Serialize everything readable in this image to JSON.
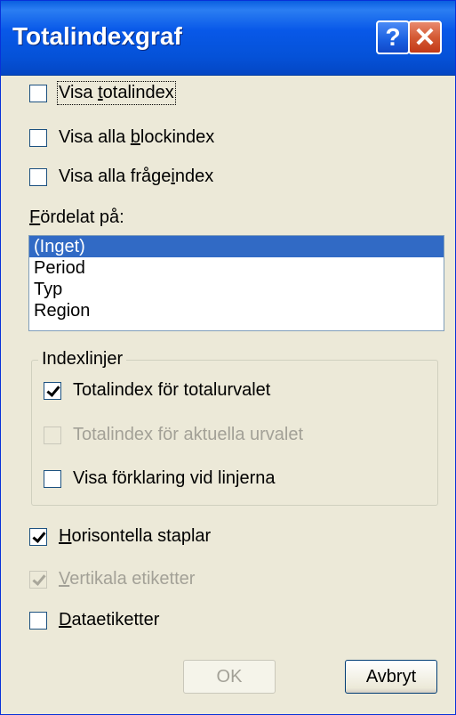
{
  "window": {
    "title": "Totalindexgraf",
    "help_label": "?",
    "close_label": "✕"
  },
  "options": [
    {
      "label_prefix": "Visa ",
      "label_key": "t",
      "label_rest": "otalindex",
      "checked": false,
      "enabled": true
    },
    {
      "label_prefix": "Visa alla ",
      "label_key": "b",
      "label_rest": "lockindex",
      "checked": false,
      "enabled": true
    },
    {
      "label_prefix": "Visa alla fråge",
      "label_key": "i",
      "label_rest": "ndex",
      "checked": false,
      "enabled": true
    }
  ],
  "distribution": {
    "label_key": "F",
    "label_rest": "ördelat på:",
    "items": [
      "(Inget)",
      "Period",
      "Typ",
      "Region"
    ],
    "selected": "(Inget)"
  },
  "index_lines": {
    "legend": "Indexlinjer",
    "options": [
      {
        "label": "Totalindex för totalurvalet",
        "checked": true,
        "enabled": true
      },
      {
        "label": "Totalindex för aktuella urvalet",
        "checked": false,
        "enabled": false
      },
      {
        "label": "Visa förklaring vid linjerna",
        "checked": false,
        "enabled": true
      }
    ]
  },
  "display": [
    {
      "label_key": "H",
      "label_rest": "orisontella staplar",
      "checked": true,
      "enabled": true
    },
    {
      "label_key": "V",
      "label_rest": "ertikala etiketter",
      "checked": true,
      "enabled": false
    },
    {
      "label_key": "D",
      "label_rest": "ataetiketter",
      "checked": false,
      "enabled": true
    }
  ],
  "buttons": {
    "ok_label": "OK",
    "cancel_label": "Avbryt"
  },
  "colors": {
    "titlebar": "#0a5fe0",
    "selection": "#316ac5",
    "dialog_bg": "#ece9d8"
  }
}
